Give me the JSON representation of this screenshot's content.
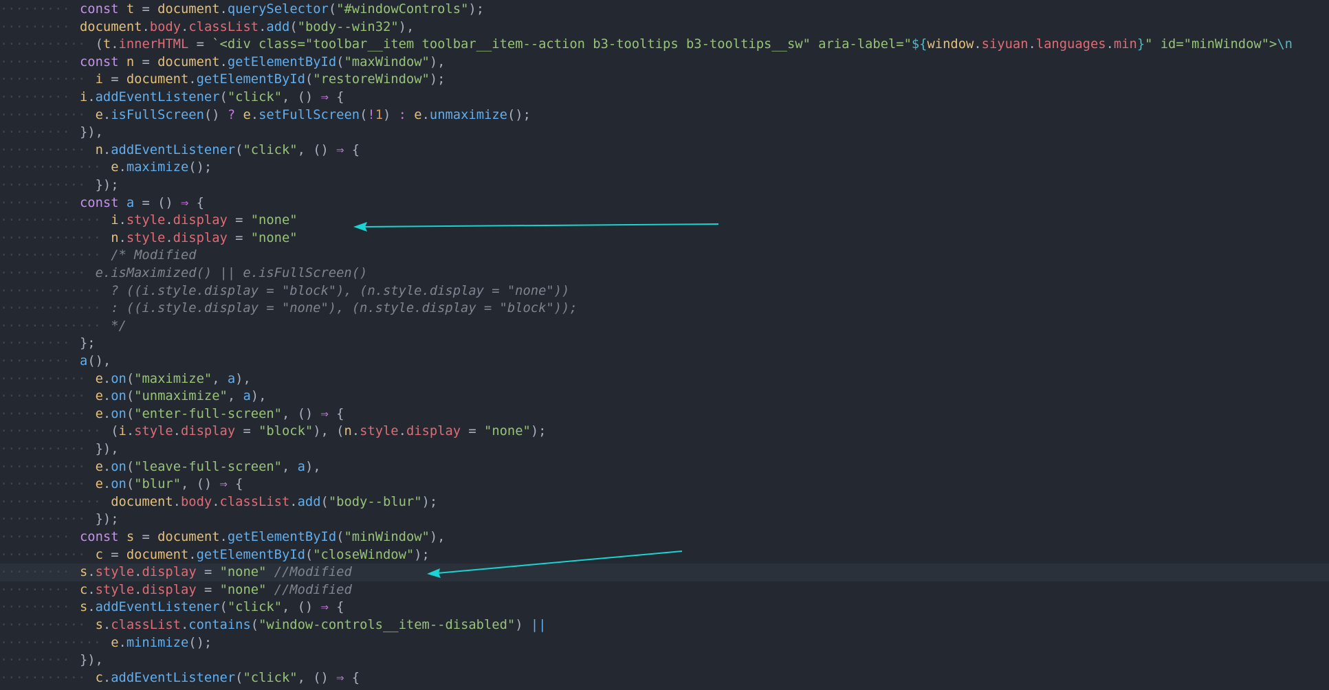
{
  "editor": {
    "lines": [
      {
        "indent": 0,
        "tokens": [
          [
            "kw",
            "const "
          ],
          [
            "var",
            "t"
          ],
          [
            "punc",
            " = "
          ],
          [
            "var",
            "document"
          ],
          [
            "punc",
            "."
          ],
          [
            "fn",
            "querySelector"
          ],
          [
            "punc",
            "("
          ],
          [
            "str",
            "\"#windowControls\""
          ],
          [
            "punc",
            ");"
          ]
        ]
      },
      {
        "indent": 0,
        "tokens": [
          [
            "var",
            "document"
          ],
          [
            "punc",
            "."
          ],
          [
            "prop",
            "body"
          ],
          [
            "punc",
            "."
          ],
          [
            "prop",
            "classList"
          ],
          [
            "punc",
            "."
          ],
          [
            "fn",
            "add"
          ],
          [
            "punc",
            "("
          ],
          [
            "str",
            "\"body--win32\""
          ],
          [
            "punc",
            "),"
          ]
        ]
      },
      {
        "indent": 1,
        "tokens": [
          [
            "punc",
            "("
          ],
          [
            "var",
            "t"
          ],
          [
            "punc",
            "."
          ],
          [
            "prop",
            "innerHTML"
          ],
          [
            "punc",
            " = "
          ],
          [
            "str",
            "`<div class=\"toolbar__item toolbar__item--action b3-tooltips b3-tooltips__sw\" aria-label=\""
          ],
          [
            "tpl",
            "${"
          ],
          [
            "var",
            "window"
          ],
          [
            "punc",
            "."
          ],
          [
            "prop",
            "siyuan"
          ],
          [
            "punc",
            "."
          ],
          [
            "prop",
            "languages"
          ],
          [
            "punc",
            "."
          ],
          [
            "prop",
            "min"
          ],
          [
            "tpl",
            "}"
          ],
          [
            "str",
            "\" id=\"minWindow\">"
          ],
          [
            "tpl",
            "\\n"
          ]
        ]
      },
      {
        "indent": 0,
        "tokens": [
          [
            "kw",
            "const "
          ],
          [
            "var",
            "n"
          ],
          [
            "punc",
            " = "
          ],
          [
            "var",
            "document"
          ],
          [
            "punc",
            "."
          ],
          [
            "fn",
            "getElementById"
          ],
          [
            "punc",
            "("
          ],
          [
            "str",
            "\"maxWindow\""
          ],
          [
            "punc",
            "),"
          ]
        ]
      },
      {
        "indent": 1,
        "tokens": [
          [
            "var",
            "i"
          ],
          [
            "punc",
            " = "
          ],
          [
            "var",
            "document"
          ],
          [
            "punc",
            "."
          ],
          [
            "fn",
            "getElementById"
          ],
          [
            "punc",
            "("
          ],
          [
            "str",
            "\"restoreWindow\""
          ],
          [
            "punc",
            ");"
          ]
        ]
      },
      {
        "indent": 0,
        "tokens": [
          [
            "var",
            "i"
          ],
          [
            "punc",
            "."
          ],
          [
            "fn",
            "addEventListener"
          ],
          [
            "punc",
            "("
          ],
          [
            "str",
            "\"click\""
          ],
          [
            "punc",
            ", () "
          ],
          [
            "op",
            "⇒"
          ],
          [
            "punc",
            " {"
          ]
        ]
      },
      {
        "indent": 1,
        "tokens": [
          [
            "var",
            "e"
          ],
          [
            "punc",
            "."
          ],
          [
            "fn",
            "isFullScreen"
          ],
          [
            "punc",
            "() "
          ],
          [
            "op",
            "?"
          ],
          [
            "punc",
            " "
          ],
          [
            "var",
            "e"
          ],
          [
            "punc",
            "."
          ],
          [
            "fn",
            "setFullScreen"
          ],
          [
            "punc",
            "("
          ],
          [
            "op",
            "!"
          ],
          [
            "num",
            "1"
          ],
          [
            "punc",
            ") "
          ],
          [
            "op",
            ":"
          ],
          [
            "punc",
            " "
          ],
          [
            "var",
            "e"
          ],
          [
            "punc",
            "."
          ],
          [
            "fn",
            "unmaximize"
          ],
          [
            "punc",
            "();"
          ]
        ]
      },
      {
        "indent": 0,
        "tokens": [
          [
            "punc",
            "}),"
          ]
        ]
      },
      {
        "indent": 1,
        "tokens": [
          [
            "var",
            "n"
          ],
          [
            "punc",
            "."
          ],
          [
            "fn",
            "addEventListener"
          ],
          [
            "punc",
            "("
          ],
          [
            "str",
            "\"click\""
          ],
          [
            "punc",
            ", () "
          ],
          [
            "op",
            "⇒"
          ],
          [
            "punc",
            " {"
          ]
        ]
      },
      {
        "indent": 2,
        "tokens": [
          [
            "var",
            "e"
          ],
          [
            "punc",
            "."
          ],
          [
            "fn",
            "maximize"
          ],
          [
            "punc",
            "();"
          ]
        ]
      },
      {
        "indent": 1,
        "tokens": [
          [
            "punc",
            "});"
          ]
        ]
      },
      {
        "indent": 0,
        "tokens": [
          [
            "kw",
            "const "
          ],
          [
            "fn",
            "a"
          ],
          [
            "punc",
            " = () "
          ],
          [
            "op",
            "⇒"
          ],
          [
            "punc",
            " {"
          ]
        ]
      },
      {
        "indent": 2,
        "tokens": [
          [
            "var",
            "i"
          ],
          [
            "punc",
            "."
          ],
          [
            "prop",
            "style"
          ],
          [
            "punc",
            "."
          ],
          [
            "prop",
            "display"
          ],
          [
            "punc",
            " = "
          ],
          [
            "str",
            "\"none\""
          ]
        ]
      },
      {
        "indent": 2,
        "tokens": [
          [
            "var",
            "n"
          ],
          [
            "punc",
            "."
          ],
          [
            "prop",
            "style"
          ],
          [
            "punc",
            "."
          ],
          [
            "prop",
            "display"
          ],
          [
            "punc",
            " = "
          ],
          [
            "str",
            "\"none\""
          ]
        ]
      },
      {
        "indent": 2,
        "tokens": [
          [
            "cmt",
            "/* Modified"
          ]
        ]
      },
      {
        "indent": 1,
        "tokens": [
          [
            "cmt",
            "e.isMaximized() || e.isFullScreen()"
          ]
        ]
      },
      {
        "indent": 2,
        "tokens": [
          [
            "cmt",
            "? ((i.style.display = \"block\"), (n.style.display = \"none\"))"
          ]
        ]
      },
      {
        "indent": 2,
        "tokens": [
          [
            "cmt",
            ": ((i.style.display = \"none\"), (n.style.display = \"block\"));"
          ]
        ]
      },
      {
        "indent": 2,
        "tokens": [
          [
            "cmt",
            "*/"
          ]
        ]
      },
      {
        "indent": 0,
        "tokens": [
          [
            "punc",
            "};"
          ]
        ]
      },
      {
        "indent": 0,
        "tokens": [
          [
            "fn",
            "a"
          ],
          [
            "punc",
            "(),"
          ]
        ]
      },
      {
        "indent": 1,
        "tokens": [
          [
            "var",
            "e"
          ],
          [
            "punc",
            "."
          ],
          [
            "fn",
            "on"
          ],
          [
            "punc",
            "("
          ],
          [
            "str",
            "\"maximize\""
          ],
          [
            "punc",
            ", "
          ],
          [
            "fn",
            "a"
          ],
          [
            "punc",
            "),"
          ]
        ]
      },
      {
        "indent": 1,
        "tokens": [
          [
            "var",
            "e"
          ],
          [
            "punc",
            "."
          ],
          [
            "fn",
            "on"
          ],
          [
            "punc",
            "("
          ],
          [
            "str",
            "\"unmaximize\""
          ],
          [
            "punc",
            ", "
          ],
          [
            "fn",
            "a"
          ],
          [
            "punc",
            "),"
          ]
        ]
      },
      {
        "indent": 1,
        "tokens": [
          [
            "var",
            "e"
          ],
          [
            "punc",
            "."
          ],
          [
            "fn",
            "on"
          ],
          [
            "punc",
            "("
          ],
          [
            "str",
            "\"enter-full-screen\""
          ],
          [
            "punc",
            ", () "
          ],
          [
            "op",
            "⇒"
          ],
          [
            "punc",
            " {"
          ]
        ]
      },
      {
        "indent": 2,
        "tokens": [
          [
            "punc",
            "("
          ],
          [
            "var",
            "i"
          ],
          [
            "punc",
            "."
          ],
          [
            "prop",
            "style"
          ],
          [
            "punc",
            "."
          ],
          [
            "prop",
            "display"
          ],
          [
            "punc",
            " = "
          ],
          [
            "str",
            "\"block\""
          ],
          [
            "punc",
            "), ("
          ],
          [
            "var",
            "n"
          ],
          [
            "punc",
            "."
          ],
          [
            "prop",
            "style"
          ],
          [
            "punc",
            "."
          ],
          [
            "prop",
            "display"
          ],
          [
            "punc",
            " = "
          ],
          [
            "str",
            "\"none\""
          ],
          [
            "punc",
            ");"
          ]
        ]
      },
      {
        "indent": 1,
        "tokens": [
          [
            "punc",
            "}),"
          ]
        ]
      },
      {
        "indent": 1,
        "tokens": [
          [
            "var",
            "e"
          ],
          [
            "punc",
            "."
          ],
          [
            "fn",
            "on"
          ],
          [
            "punc",
            "("
          ],
          [
            "str",
            "\"leave-full-screen\""
          ],
          [
            "punc",
            ", "
          ],
          [
            "fn",
            "a"
          ],
          [
            "punc",
            "),"
          ]
        ]
      },
      {
        "indent": 1,
        "tokens": [
          [
            "var",
            "e"
          ],
          [
            "punc",
            "."
          ],
          [
            "fn",
            "on"
          ],
          [
            "punc",
            "("
          ],
          [
            "str",
            "\"blur\""
          ],
          [
            "punc",
            ", () "
          ],
          [
            "op",
            "⇒"
          ],
          [
            "punc",
            " {"
          ]
        ]
      },
      {
        "indent": 2,
        "tokens": [
          [
            "var",
            "document"
          ],
          [
            "punc",
            "."
          ],
          [
            "prop",
            "body"
          ],
          [
            "punc",
            "."
          ],
          [
            "prop",
            "classList"
          ],
          [
            "punc",
            "."
          ],
          [
            "fn",
            "add"
          ],
          [
            "punc",
            "("
          ],
          [
            "str",
            "\"body--blur\""
          ],
          [
            "punc",
            ");"
          ]
        ]
      },
      {
        "indent": 1,
        "tokens": [
          [
            "punc",
            "});"
          ]
        ]
      },
      {
        "indent": 0,
        "tokens": [
          [
            "kw",
            "const "
          ],
          [
            "var",
            "s"
          ],
          [
            "punc",
            " = "
          ],
          [
            "var",
            "document"
          ],
          [
            "punc",
            "."
          ],
          [
            "fn",
            "getElementById"
          ],
          [
            "punc",
            "("
          ],
          [
            "str",
            "\"minWindow\""
          ],
          [
            "punc",
            "),"
          ]
        ]
      },
      {
        "indent": 1,
        "tokens": [
          [
            "var",
            "c"
          ],
          [
            "punc",
            " = "
          ],
          [
            "var",
            "document"
          ],
          [
            "punc",
            "."
          ],
          [
            "fn",
            "getElementById"
          ],
          [
            "punc",
            "("
          ],
          [
            "str",
            "\"closeWindow\""
          ],
          [
            "punc",
            ");"
          ]
        ]
      },
      {
        "indent": 0,
        "current": true,
        "tokens": [
          [
            "var",
            "s"
          ],
          [
            "punc",
            "."
          ],
          [
            "prop",
            "style"
          ],
          [
            "punc",
            "."
          ],
          [
            "prop",
            "display"
          ],
          [
            "punc",
            " = "
          ],
          [
            "str",
            "\"none\""
          ],
          [
            "punc",
            " "
          ],
          [
            "cmt",
            "//Modified"
          ]
        ]
      },
      {
        "indent": 0,
        "tokens": [
          [
            "var",
            "c"
          ],
          [
            "punc",
            "."
          ],
          [
            "prop",
            "style"
          ],
          [
            "punc",
            "."
          ],
          [
            "prop",
            "display"
          ],
          [
            "punc",
            " = "
          ],
          [
            "str",
            "\"none\""
          ],
          [
            "punc",
            " "
          ],
          [
            "cmt",
            "//Modified"
          ]
        ]
      },
      {
        "indent": 0,
        "tokens": [
          [
            "var",
            "s"
          ],
          [
            "punc",
            "."
          ],
          [
            "fn",
            "addEventListener"
          ],
          [
            "punc",
            "("
          ],
          [
            "str",
            "\"click\""
          ],
          [
            "punc",
            ", () "
          ],
          [
            "op",
            "⇒"
          ],
          [
            "punc",
            " {"
          ]
        ]
      },
      {
        "indent": 1,
        "tokens": [
          [
            "var",
            "s"
          ],
          [
            "punc",
            "."
          ],
          [
            "prop",
            "classList"
          ],
          [
            "punc",
            "."
          ],
          [
            "fn",
            "contains"
          ],
          [
            "punc",
            "("
          ],
          [
            "str",
            "\"window-controls__item--disabled\""
          ],
          [
            "punc",
            ") "
          ],
          [
            "fn",
            "||"
          ]
        ]
      },
      {
        "indent": 2,
        "tokens": [
          [
            "var",
            "e"
          ],
          [
            "punc",
            "."
          ],
          [
            "fn",
            "minimize"
          ],
          [
            "punc",
            "();"
          ]
        ]
      },
      {
        "indent": 0,
        "tokens": [
          [
            "punc",
            "}),"
          ]
        ]
      },
      {
        "indent": 1,
        "tokens": [
          [
            "var",
            "c"
          ],
          [
            "punc",
            "."
          ],
          [
            "fn",
            "addEventListener"
          ],
          [
            "punc",
            "("
          ],
          [
            "str",
            "\"click\""
          ],
          [
            "punc",
            ", () "
          ],
          [
            "op",
            "⇒"
          ],
          [
            "punc",
            " {"
          ]
        ]
      }
    ]
  },
  "colors": {
    "background": "#232831",
    "arrow": "#1ad3d3"
  },
  "annotations": [
    "arrow-to-i-style-display",
    "arrow-to-s-style-display"
  ]
}
